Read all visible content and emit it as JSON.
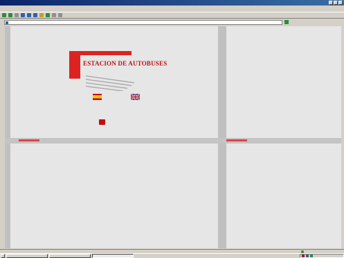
{
  "window": {
    "title": "",
    "controls": [
      "minimize",
      "maximize",
      "close"
    ]
  },
  "menu": {
    "items": [
      "",
      "",
      "",
      "",
      "",
      "",
      ""
    ]
  },
  "toolbar": {
    "icons": [
      "back-icon",
      "forward-icon",
      "stop-icon",
      "refresh-icon",
      "home-icon",
      "search-icon",
      "favorites-icon",
      "history-icon",
      "mail-icon",
      "print-icon"
    ]
  },
  "address": {
    "label": "",
    "url": "",
    "links_label": ""
  },
  "page": {
    "logo_title": "ESTACION DE AUTOBUSES",
    "logo_subtitle": "",
    "flag_es_label": "",
    "flag_uk_label": "",
    "tagline": "",
    "address_line": "",
    "phone": "",
    "email": ""
  },
  "status": {
    "text": ""
  },
  "taskbar": {
    "start_label": "",
    "tasks": [
      "",
      "",
      ""
    ],
    "active_task_index": 2
  },
  "colors": {
    "brand_red": "#c01010",
    "title_blue": "#0a246a",
    "content_bg": "#e6e6e6"
  }
}
